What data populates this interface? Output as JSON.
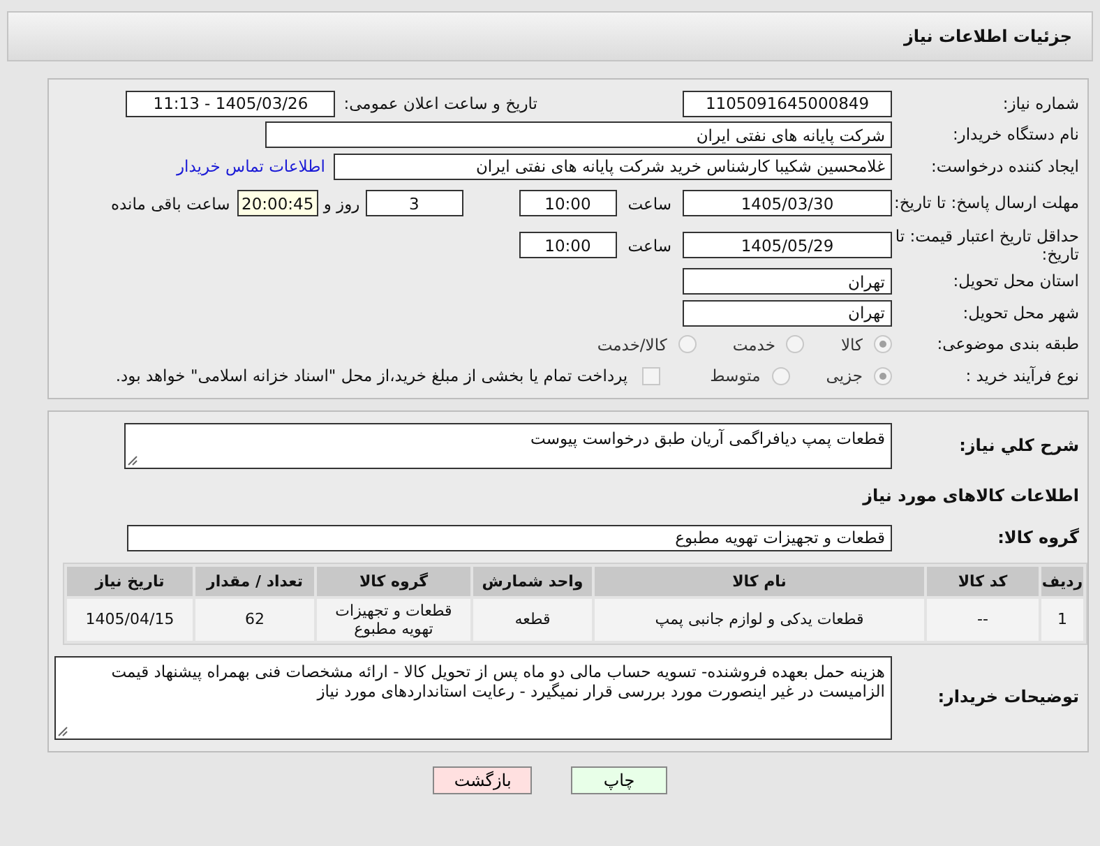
{
  "header": {
    "title": "جزئیات اطلاعات نیاز"
  },
  "need_number": {
    "label": "شماره نیاز:",
    "value": "1105091645000849"
  },
  "announce": {
    "label": "تاریخ و ساعت اعلان عمومی:",
    "value": "1405/03/26 - 11:13"
  },
  "buyer_org": {
    "label": "نام دستگاه خریدار:",
    "value": "شرکت پایانه های نفتی ایران"
  },
  "creator": {
    "label": "ایجاد کننده درخواست:",
    "value": "غلامحسین شکیبا کارشناس خرید شرکت پایانه های نفتی ایران",
    "link": "اطلاعات تماس خریدار"
  },
  "deadline": {
    "label": "مهلت ارسال پاسخ: تا تاریخ:",
    "date": "1405/03/30",
    "time_label": "ساعت",
    "time": "10:00",
    "days": "3",
    "days_label": "روز و",
    "remaining": "20:00:45",
    "remaining_label": "ساعت باقی مانده"
  },
  "price_validity": {
    "label": "حداقل تاریخ اعتبار قیمت: تا تاریخ:",
    "date": "1405/05/29",
    "time_label": "ساعت",
    "time": "10:00"
  },
  "province": {
    "label": "استان محل تحویل:",
    "value": "تهران"
  },
  "city": {
    "label": "شهر محل تحویل:",
    "value": "تهران"
  },
  "category": {
    "label": "طبقه بندی موضوعی:",
    "options": [
      {
        "label": "کالا",
        "selected": true
      },
      {
        "label": "خدمت",
        "selected": false
      },
      {
        "label": "کالا/خدمت",
        "selected": false
      }
    ]
  },
  "purchase_type": {
    "label": "نوع فرآیند خرید :",
    "options": [
      {
        "label": "جزیی",
        "selected": true
      },
      {
        "label": "متوسط",
        "selected": false
      }
    ],
    "payment_option": {
      "label": "پرداخت تمام یا بخشی از مبلغ خرید،از محل \"اسناد خزانه اسلامی\" خواهد بود.",
      "checked": false
    }
  },
  "description": {
    "label": "شرح کلي نیاز:",
    "value": "قطعات پمپ دیافراگمی آریان طبق درخواست پیوست"
  },
  "goods_heading": "اطلاعات کالاهای مورد نیاز",
  "goods_group": {
    "label": "گروه کالا:",
    "value": "قطعات و تجهیزات تهویه مطبوع"
  },
  "table": {
    "columns": [
      "ردیف",
      "کد کالا",
      "نام کالا",
      "واحد شمارش",
      "گروه کالا",
      "تعداد / مقدار",
      "تاریخ نیاز"
    ],
    "rows": [
      [
        "1",
        "--",
        "قطعات یدکی و لوازم جانبی پمپ",
        "قطعه",
        "قطعات و تجهیزات تهویه مطبوع",
        "62",
        "1405/04/15"
      ]
    ]
  },
  "buyer_notes": {
    "label": "توضیحات خریدار:",
    "value": "هزینه حمل بعهده فروشنده- تسویه حساب مالی دو ماه پس از تحویل کالا - ارائه مشخصات فنی بهمراه پیشنهاد قیمت الزامیست در غیر اینصورت مورد بررسی قرار نمیگیرد - رعایت استانداردهای مورد نیاز"
  },
  "buttons": [
    {
      "label": "چاپ",
      "kind": "print"
    },
    {
      "label": "بازگشت",
      "kind": "back"
    }
  ]
}
